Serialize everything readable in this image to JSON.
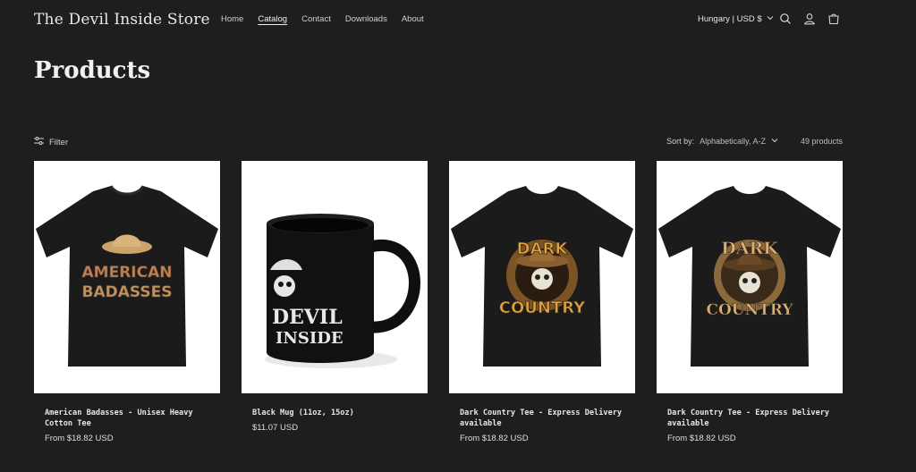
{
  "header": {
    "store_name": "The Devil Inside Store",
    "nav": [
      "Home",
      "Catalog",
      "Contact",
      "Downloads",
      "About"
    ],
    "active_nav": "Catalog",
    "locale": "Hungary | USD $",
    "icons": [
      "search-icon",
      "account-icon",
      "cart-icon"
    ]
  },
  "page": {
    "title": "Products"
  },
  "toolbar": {
    "filter_label": "Filter",
    "sort_label": "Sort by:",
    "sort_value": "Alphabetically, A-Z",
    "product_count": "49 products"
  },
  "products": [
    {
      "name": "American Badasses - Unisex Heavy Cotton Tee",
      "price": "From $18.82 USD",
      "graphic_text": [
        "AMERICAN",
        "BADASSES"
      ]
    },
    {
      "name": "Black Mug (11oz, 15oz)",
      "price": "$11.07 USD",
      "graphic_text": [
        "DEVIL",
        "INSIDE"
      ]
    },
    {
      "name": "Dark Country Tee - Express Delivery available",
      "price": "From $18.82 USD",
      "graphic_text": [
        "DARK",
        "COUNTRY"
      ]
    },
    {
      "name": "Dark Country Tee - Express Delivery available",
      "price": "From $18.82 USD",
      "graphic_text": [
        "DARK",
        "COUNTRY"
      ]
    }
  ],
  "colors": {
    "background": "#1e1e20",
    "text": "#e6e6e6",
    "card_bg": "#ffffff",
    "shirt": "#1a1a1a",
    "print_gold": "#c8964a"
  }
}
